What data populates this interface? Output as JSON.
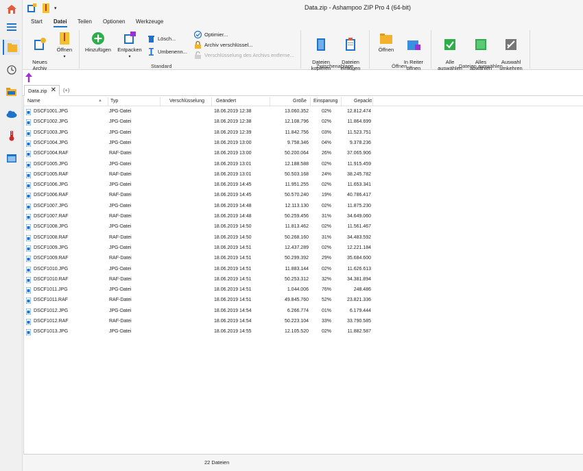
{
  "window": {
    "title": "Data.zip - Ashampoo ZIP Pro 4 (64-bit)"
  },
  "ribbon_tabs": [
    "Start",
    "Datei",
    "Teilen",
    "Optionen",
    "Werkzeuge"
  ],
  "ribbon": {
    "new_archive": "Neues\nArchiv",
    "open": "Öffnen",
    "add": "Hinzufügen",
    "extract": "Entpacken",
    "delete": "Lösch...",
    "rename": "Umbenenn...",
    "optimize": "Optimier...",
    "encrypt": "Archiv verschlüssel...",
    "remove_encryption": "Verschlüsselung des Archivs entferne...",
    "copy_files": "Dateien\nkopieren",
    "paste_files": "Dateien\neinfügen",
    "open2": "Öffnen",
    "open_in_tab": "In Reiter\nöffnen",
    "select_all": "Alle\nauswählen",
    "deselect_all": "Alles\nabwählen",
    "invert_selection": "Auswahl\numkehren",
    "group_standard": "Standard",
    "group_clipboard": "Zwischenablage",
    "group_open": "Öffnen",
    "group_select": "Dateien auswählen"
  },
  "doc_tab": {
    "name": "Data.zip",
    "add": "(+)"
  },
  "columns": [
    "Name",
    "Typ",
    "Verschlüsselung",
    "Geändert",
    "Größe",
    "Einsparung",
    "Gepackt"
  ],
  "files": [
    {
      "name": "DSCF1001.JPG",
      "type": "JPG-Datei",
      "encryption": "",
      "modified": "18.06.2019 12:38",
      "size": "13.060.352",
      "saving": "02%",
      "packed": "12.812.474"
    },
    {
      "name": "DSCF1002.JPG",
      "type": "JPG-Datei",
      "encryption": "",
      "modified": "18.06.2019 12:38",
      "size": "12.108.796",
      "saving": "02%",
      "packed": "11.864.699"
    },
    {
      "name": "DSCF1003.JPG",
      "type": "JPG-Datei",
      "encryption": "",
      "modified": "18.06.2019 12:39",
      "size": "11.842.756",
      "saving": "03%",
      "packed": "11.523.751"
    },
    {
      "name": "DSCF1004.JPG",
      "type": "JPG-Datei",
      "encryption": "",
      "modified": "18.06.2019 13:00",
      "size": "9.758.346",
      "saving": "04%",
      "packed": "9.378.236"
    },
    {
      "name": "DSCF1004.RAF",
      "type": "RAF-Datei",
      "encryption": "",
      "modified": "18.06.2019 13:00",
      "size": "50.200.064",
      "saving": "26%",
      "packed": "37.065.906"
    },
    {
      "name": "DSCF1005.JPG",
      "type": "JPG-Datei",
      "encryption": "",
      "modified": "18.06.2019 13:01",
      "size": "12.188.588",
      "saving": "02%",
      "packed": "11.915.459"
    },
    {
      "name": "DSCF1005.RAF",
      "type": "RAF-Datei",
      "encryption": "",
      "modified": "18.06.2019 13:01",
      "size": "50.503.168",
      "saving": "24%",
      "packed": "38.245.782"
    },
    {
      "name": "DSCF1006.JPG",
      "type": "JPG-Datei",
      "encryption": "",
      "modified": "18.06.2019 14:45",
      "size": "11.951.255",
      "saving": "02%",
      "packed": "11.653.341"
    },
    {
      "name": "DSCF1006.RAF",
      "type": "RAF-Datei",
      "encryption": "",
      "modified": "18.06.2019 14:45",
      "size": "50.570.240",
      "saving": "19%",
      "packed": "40.786.417"
    },
    {
      "name": "DSCF1007.JPG",
      "type": "JPG-Datei",
      "encryption": "",
      "modified": "18.06.2019 14:48",
      "size": "12.113.130",
      "saving": "02%",
      "packed": "11.875.230"
    },
    {
      "name": "DSCF1007.RAF",
      "type": "RAF-Datei",
      "encryption": "",
      "modified": "18.06.2019 14:48",
      "size": "50.259.456",
      "saving": "31%",
      "packed": "34.649.060"
    },
    {
      "name": "DSCF1008.JPG",
      "type": "JPG-Datei",
      "encryption": "",
      "modified": "18.06.2019 14:50",
      "size": "11.813.462",
      "saving": "02%",
      "packed": "11.561.467"
    },
    {
      "name": "DSCF1008.RAF",
      "type": "RAF-Datei",
      "encryption": "",
      "modified": "18.06.2019 14:50",
      "size": "50.268.160",
      "saving": "31%",
      "packed": "34.483.592"
    },
    {
      "name": "DSCF1009.JPG",
      "type": "JPG-Datei",
      "encryption": "",
      "modified": "18.06.2019 14:51",
      "size": "12.437.289",
      "saving": "02%",
      "packed": "12.221.184"
    },
    {
      "name": "DSCF1009.RAF",
      "type": "RAF-Datei",
      "encryption": "",
      "modified": "18.06.2019 14:51",
      "size": "50.299.392",
      "saving": "29%",
      "packed": "35.684.600"
    },
    {
      "name": "DSCF1010.JPG",
      "type": "JPG-Datei",
      "encryption": "",
      "modified": "18.06.2019 14:51",
      "size": "11.883.144",
      "saving": "02%",
      "packed": "11.626.613"
    },
    {
      "name": "DSCF1010.RAF",
      "type": "RAF-Datei",
      "encryption": "",
      "modified": "18.06.2019 14:51",
      "size": "50.253.312",
      "saving": "32%",
      "packed": "34.381.894"
    },
    {
      "name": "DSCF1011.JPG",
      "type": "JPG-Datei",
      "encryption": "",
      "modified": "18.06.2019 14:51",
      "size": "1.044.006",
      "saving": "76%",
      "packed": "248.486"
    },
    {
      "name": "DSCF1011.RAF",
      "type": "RAF-Datei",
      "encryption": "",
      "modified": "18.06.2019 14:51",
      "size": "49.845.760",
      "saving": "52%",
      "packed": "23.821.336"
    },
    {
      "name": "DSCF1012.JPG",
      "type": "JPG-Datei",
      "encryption": "",
      "modified": "18.06.2019 14:54",
      "size": "6.266.774",
      "saving": "01%",
      "packed": "6.179.444"
    },
    {
      "name": "DSCF1012.RAF",
      "type": "RAF-Datei",
      "encryption": "",
      "modified": "18.06.2019 14:54",
      "size": "50.223.104",
      "saving": "33%",
      "packed": "33.790.585"
    },
    {
      "name": "DSCF1013.JPG",
      "type": "JPG-Datei",
      "encryption": "",
      "modified": "18.06.2019 14:55",
      "size": "12.105.520",
      "saving": "02%",
      "packed": "11.882.587"
    }
  ],
  "status": {
    "count": "22 Dateien"
  },
  "colors": {
    "accent": "#1e73c9",
    "folder": "#f2b22c",
    "green": "#2dae4a",
    "purple": "#9b30d9"
  }
}
